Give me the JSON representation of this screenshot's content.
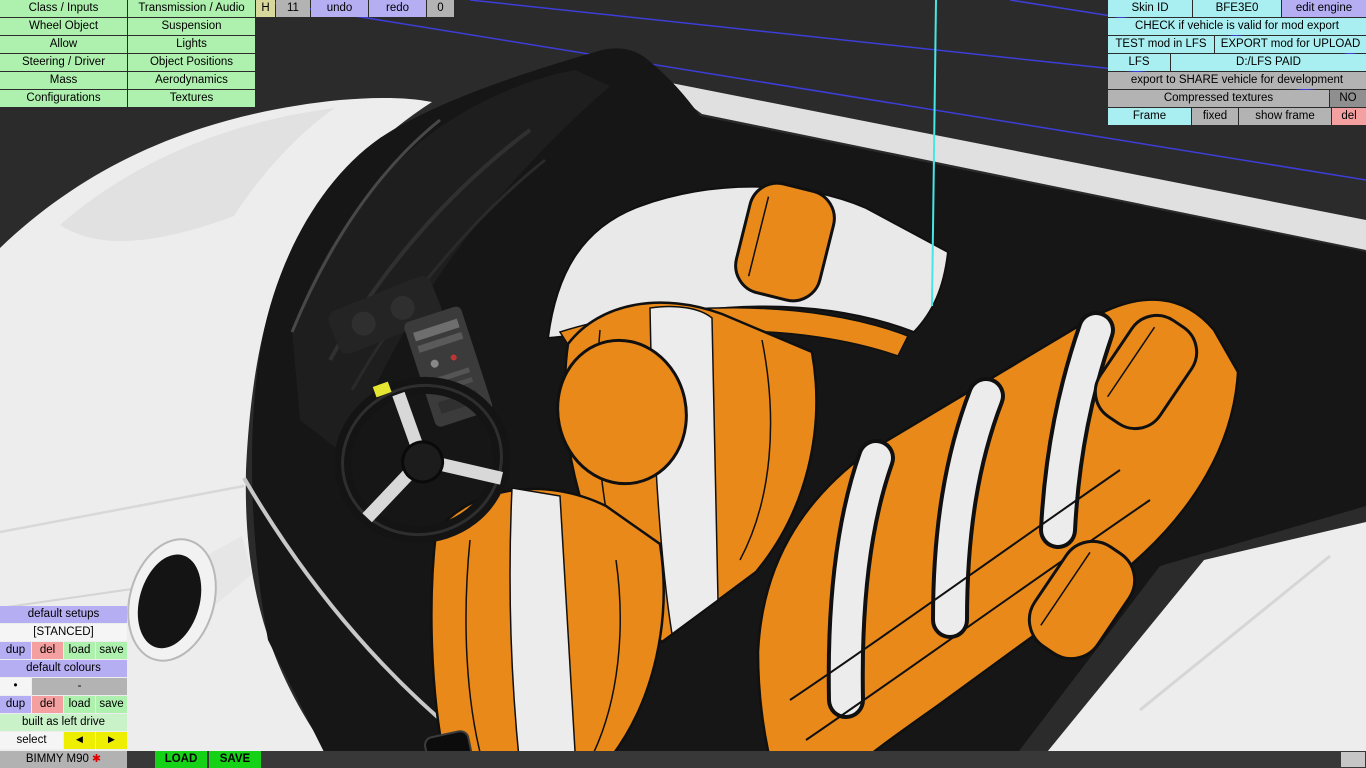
{
  "colors": {
    "viewport_bg": "#2b2b2b",
    "grid_blue": "#3d3dd8",
    "axis_cyan": "#45e6e6",
    "car_body": "#ededed",
    "seat_orange": "#e8891a",
    "button_green": "#aef0ae",
    "button_purple": "#b6aef2",
    "button_cyan": "#a9eef0"
  },
  "menu": {
    "col1": [
      "Class / Inputs",
      "Wheel Object",
      "Allow",
      "Steering / Driver",
      "Mass",
      "Configurations"
    ],
    "col2": [
      "Transmission / Audio",
      "Suspension",
      "Lights",
      "Object Positions",
      "Aerodynamics",
      "Textures"
    ]
  },
  "toolbar": {
    "h": "H",
    "h_value": "11",
    "undo": "undo",
    "redo": "redo",
    "zero": "0"
  },
  "mod_panel": {
    "skin_id_label": "Skin ID",
    "skin_id_value": "BFE3E0",
    "edit_engine": "edit engine",
    "check_row": "CHECK if vehicle is valid for mod export",
    "test_button": "TEST mod in LFS",
    "export_button": "EXPORT mod for UPLOAD",
    "lfs_button": "LFS",
    "lfs_path": "D:/LFS PAID",
    "share_row": "export to SHARE vehicle for development",
    "compressed_label": "Compressed textures",
    "compressed_value": "NO",
    "frame_label": "Frame",
    "frame_fixed": "fixed",
    "frame_show": "show frame",
    "frame_del": "del"
  },
  "setups_panel": {
    "default_setups": "default setups",
    "setup_name": "[STANCED]",
    "dup": "dup",
    "del": "del",
    "load": "load",
    "save": "save",
    "default_colours": "default colours",
    "colour_dot": "•",
    "colour_value": "-",
    "built_drive": "built as left drive",
    "select": "select",
    "prev_arrow": "◄",
    "next_arrow": "►"
  },
  "statusbar": {
    "vehicle_name": "BIMMY M90",
    "modified_marker": "✱",
    "load": "LOAD",
    "save": "SAVE"
  }
}
